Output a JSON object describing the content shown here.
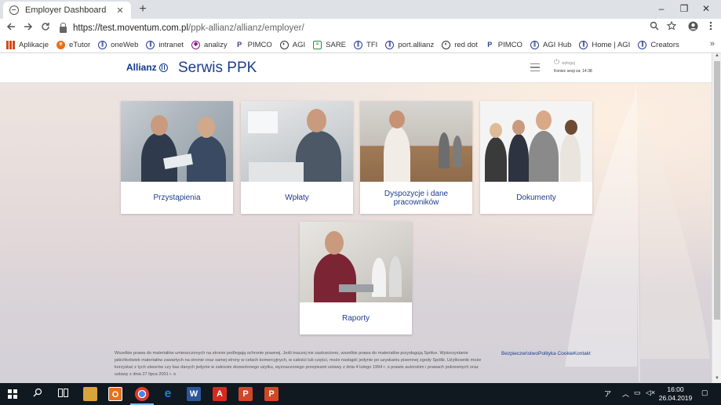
{
  "browser": {
    "tab_title": "Employer Dashboard",
    "tab_close": "✕",
    "new_tab": "+",
    "window_controls": {
      "minimize": "–",
      "maximize": "❐",
      "close": "✕"
    },
    "url_host": "https://test.moventum.com.pl",
    "url_path": "/ppk-allianz/allianz/employer/",
    "bookmarks": [
      {
        "label": "Aplikacje",
        "icon": "apps-grid-icon"
      },
      {
        "label": "eTutor",
        "icon": "etutor-icon"
      },
      {
        "label": "oneWeb",
        "icon": "allianz-icon"
      },
      {
        "label": "intranet",
        "icon": "allianz-icon"
      },
      {
        "label": "analizy",
        "icon": "analizy-icon"
      },
      {
        "label": "PIMCO",
        "icon": "pimco-icon"
      },
      {
        "label": "AGI",
        "icon": "agi-icon"
      },
      {
        "label": "SARE",
        "icon": "sare-icon"
      },
      {
        "label": "TFI",
        "icon": "allianz-icon"
      },
      {
        "label": "port.allianz",
        "icon": "allianz-icon"
      },
      {
        "label": "red dot",
        "icon": "agi-icon"
      },
      {
        "label": "PIMCO",
        "icon": "pimco-icon"
      },
      {
        "label": "AGI Hub",
        "icon": "allianz-icon"
      },
      {
        "label": "Home | AGI",
        "icon": "allianz-icon"
      },
      {
        "label": "Creators",
        "icon": "allianz-icon"
      }
    ],
    "bookmarks_more": "»"
  },
  "header": {
    "brand": "Allianz",
    "title": "Serwis PPK",
    "session_label": "wyloguj",
    "session_time": "Koniec sesji za: 14:38"
  },
  "tiles": [
    {
      "label": "Przystąpienia"
    },
    {
      "label": "Wpłaty"
    },
    {
      "label": "Dyspozycje i dane pracowników"
    },
    {
      "label": "Dokumenty"
    },
    {
      "label": "Raporty"
    }
  ],
  "footer": {
    "legal": "Wszelkie prawa do materiałów umieszczonych na stronie podlegają ochronie prawnej. Jeśli inaczej nie zastrzeżono, wszelkie prawa do materiałów przysługują Spółce. Wykorzystanie jakichkolwiek materiałów zawartych na stronie oraz samej strony w celach komercyjnych, w całości lub części, może nastąpić jedynie po uzyskaniu pisemnej zgody Spółki. Użytkownik może korzystać z tych utworów czy baz danych jedynie w zakresie dozwolonego użytku, wyznaczonego przepisami ustawy z dnia 4 lutego 1994 r. o prawie autorskim i prawach pokrewnych oraz ustawy z dnia 27 lipca 2001 r. o",
    "links": [
      "Bezpieczeństwo",
      "Polityka Cookie",
      "Kontakt"
    ]
  },
  "taskbar": {
    "clock_time": "16:00",
    "clock_date": "26.04.2019",
    "apps": [
      {
        "name": "outlook",
        "letter": "O",
        "color": "#e8711c"
      },
      {
        "name": "chrome",
        "letter": "",
        "color": "#dd3b2c"
      },
      {
        "name": "edge",
        "letter": "e",
        "color": "#1f7bd4"
      },
      {
        "name": "word",
        "letter": "W",
        "color": "#2b579a"
      },
      {
        "name": "acrobat",
        "letter": "A",
        "color": "#d52b1e"
      },
      {
        "name": "powerpoint",
        "letter": "P",
        "color": "#d24726"
      },
      {
        "name": "powerpoint2",
        "letter": "P",
        "color": "#d24726"
      }
    ],
    "tray_text": "ア"
  }
}
